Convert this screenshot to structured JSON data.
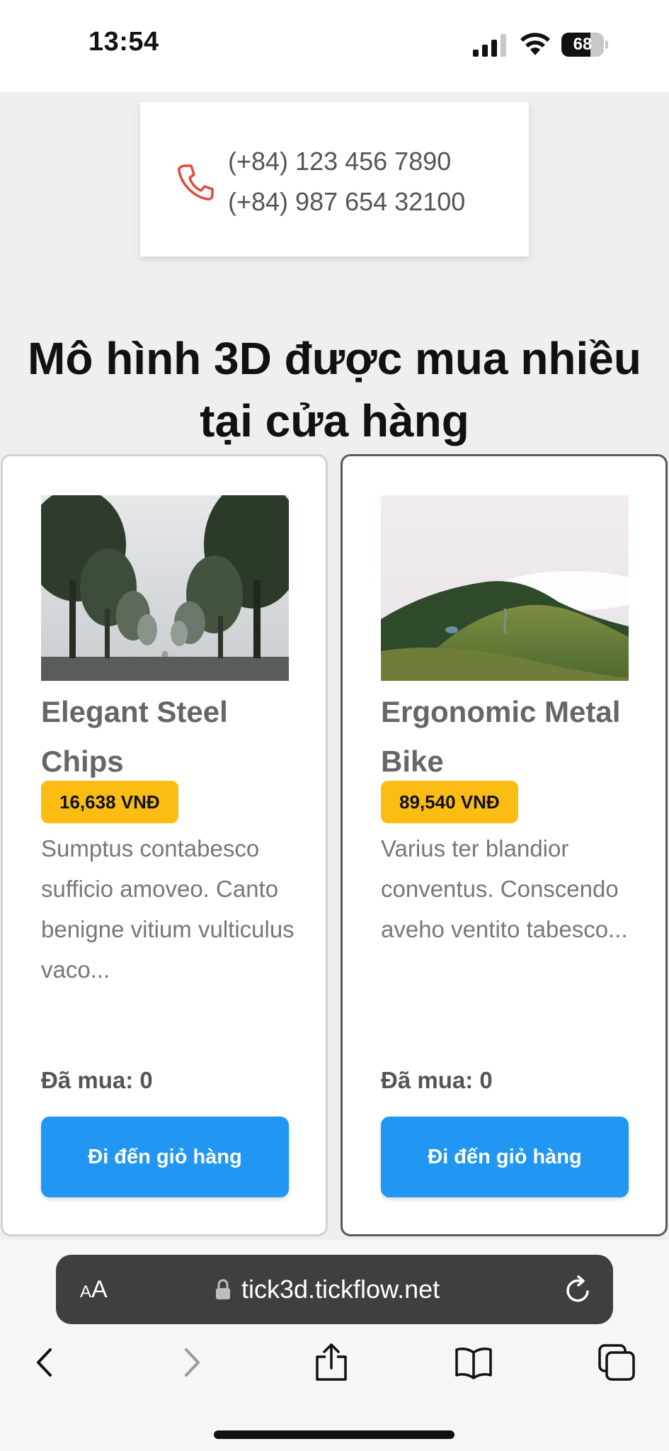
{
  "status_bar": {
    "time": "13:54",
    "battery_level": "68",
    "icons": [
      "signal-icon",
      "wifi-icon",
      "battery-icon"
    ]
  },
  "contact": {
    "icon": "phone-icon",
    "phones": [
      "(+84) 123 456 7890",
      "(+84) 987 654 32100"
    ]
  },
  "section_title": "Mô hình 3D được mua nhiều tại cửa hàng",
  "products": [
    {
      "name": "Elegant Steel Chips",
      "price": "16,638 VNĐ",
      "description": "Sumptus contabesco sufficio amoveo. Canto benigne vitium vulticulus vaco...",
      "purchased": "Đã mua: 0",
      "button_label": "Đi đến giỏ hàng",
      "image": "tree-lined-road-photo"
    },
    {
      "name": "Ergonomic Metal Bike",
      "price": "89,540 VNĐ",
      "description": "Varius ter blandior conventus. Conscendo aveho ventito tabesco...",
      "purchased": "Đã mua: 0",
      "button_label": "Đi đến giỏ hàng",
      "image": "green-hills-fog-photo"
    }
  ],
  "browser": {
    "aa_label_small": "A",
    "aa_label_large": "A",
    "url": "tick3d.tickflow.net",
    "nav_icons": [
      "back-icon",
      "forward-icon",
      "share-icon",
      "bookmarks-icon",
      "tabs-icon"
    ]
  },
  "colors": {
    "accent_blue": "#2196f3",
    "price_yellow": "#fbbd14",
    "phone_red": "#e04a3b"
  }
}
